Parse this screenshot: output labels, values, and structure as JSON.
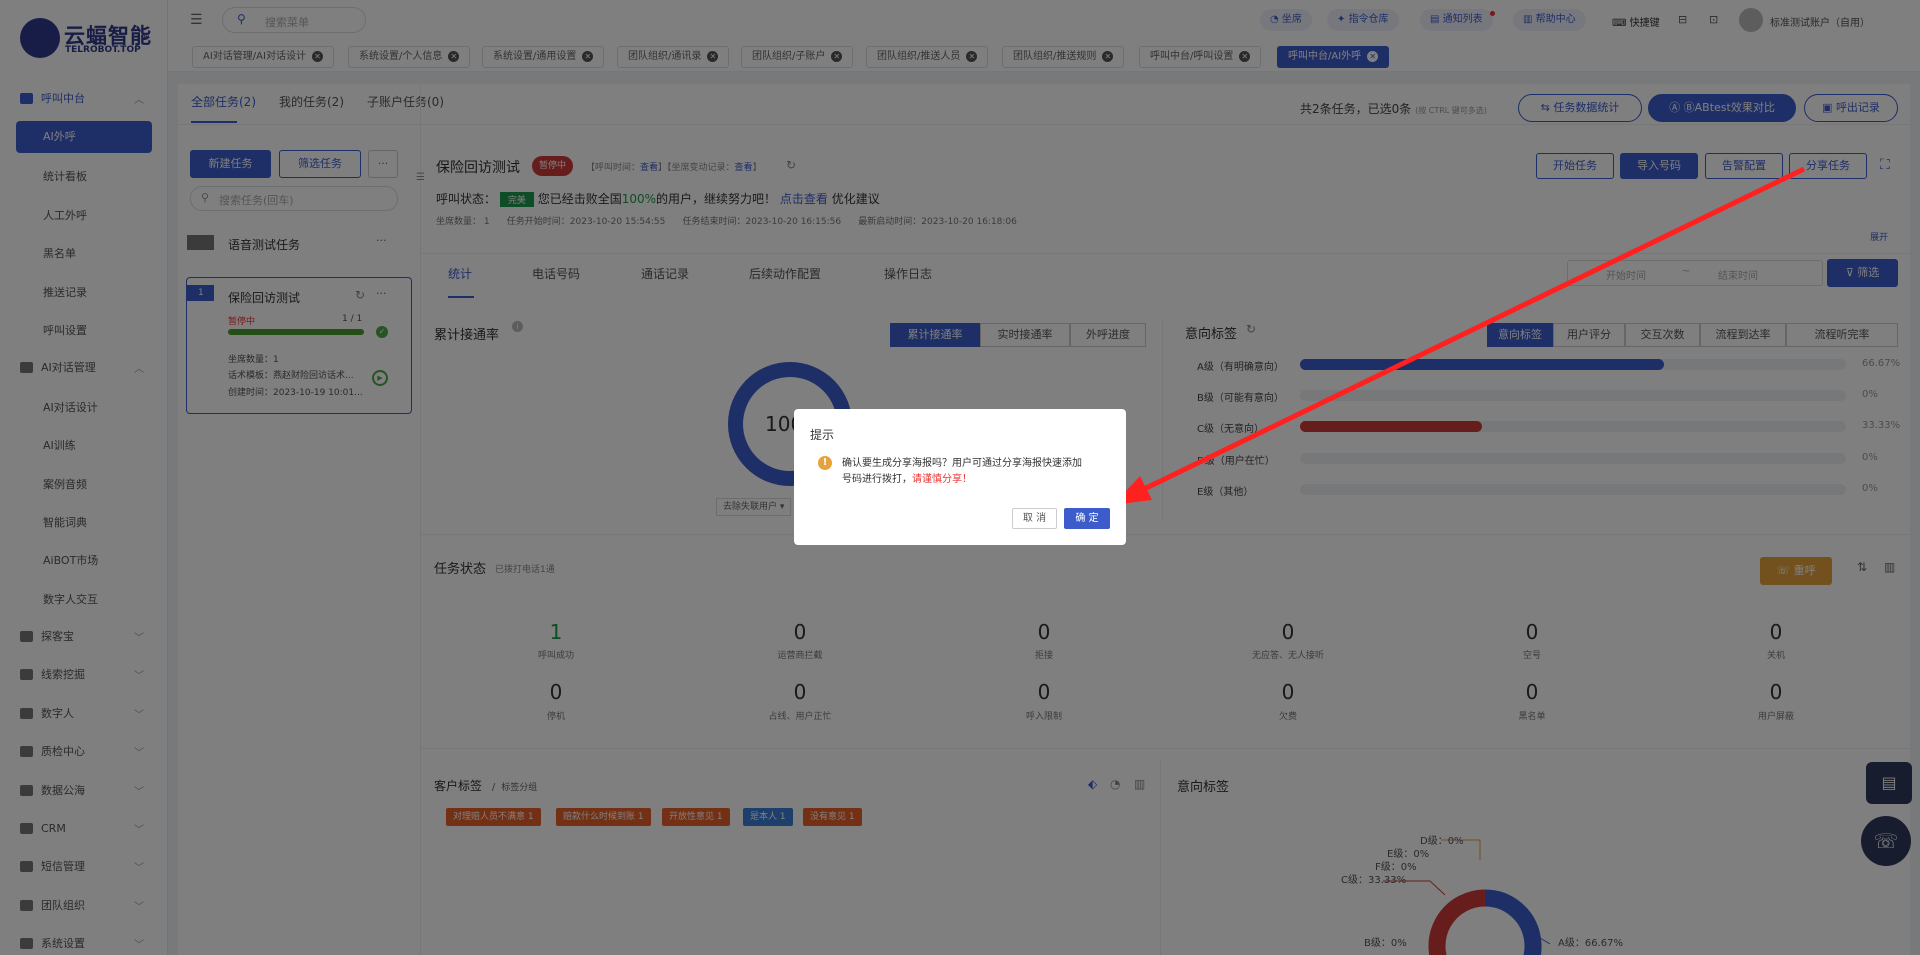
{
  "brand": {
    "name": "云蝠智能",
    "domain": "TELROBOT.TOP",
    "reg": "®"
  },
  "topbar": {
    "search_placeholder": "搜索菜单",
    "buttons": [
      "坐席",
      "指令仓库",
      "通知列表",
      "帮助中心"
    ],
    "shortcut": "快捷键",
    "account": "标准测试账户（自用）"
  },
  "page_tabs": [
    "AI对话管理/AI对话设计",
    "系统设置/个人信息",
    "系统设置/通用设置",
    "团队组织/通讯录",
    "团队组织/子账户",
    "团队组织/推送人员",
    "团队组织/推送规则",
    "呼叫中台/呼叫设置",
    "呼叫中台/AI外呼"
  ],
  "sidebar": {
    "group1": "呼叫中台",
    "group1_items": [
      "AI外呼",
      "统计看板",
      "人工外呼",
      "黑名单",
      "推送记录",
      "呼叫设置"
    ],
    "group2": "AI对话管理",
    "group2_items": [
      "AI对话设计",
      "AI训练",
      "案例音频",
      "智能词典",
      "AiBOT市场",
      "数字人交互"
    ],
    "groups": [
      "探客宝",
      "线索挖掘",
      "数字人",
      "质检中心",
      "数据公海",
      "CRM",
      "短信管理",
      "团队组织",
      "系统设置"
    ]
  },
  "task_tabs": [
    "全部任务(2)",
    "我的任务(2)",
    "子账户任务(0)"
  ],
  "task_summary": {
    "text": "共2条任务，已选0条",
    "hint": "(按 CTRL 键可多选)"
  },
  "top_actions": [
    "任务数据统计",
    "ABtest效果对比",
    "呼出记录"
  ],
  "left": {
    "new_task": "新建任务",
    "filter_task": "筛选任务",
    "more": "···",
    "search_placeholder": "搜索任务(回车)",
    "voice_task": "语音测试任务",
    "card": {
      "index": "1",
      "title": "保险回访测试",
      "status": "暂停中",
      "progress": "1 / 1",
      "progress_ratio": 1.0,
      "seats": "坐席数量：1",
      "template": "话术模板：燕赵财险回访话术...",
      "created": "创建时间：2023-10-19 10:01..."
    }
  },
  "detail": {
    "title": "保险回访测试",
    "status": "暂停中",
    "call_time_label": "【呼叫时间：",
    "view": "查看",
    "seat_label": "】【坐席变动记录：",
    "view2": "查看",
    "close_bracket": "】",
    "call_status_label": "呼叫状态：",
    "done": "完美",
    "msg_pre": "您已经击败全国",
    "msg_pct": "100%",
    "msg_post": "的用户，继续努力吧！",
    "click_view": "点击查看",
    "optimize": "优化建议",
    "meta": [
      "坐席数量：  1",
      "任务开始时间：2023-10-20 15:54:55",
      "任务结束时间：2023-10-20 16:15:56",
      "最新启动时间：2023-10-20 16:18:06"
    ],
    "actions": [
      "开始任务",
      "导入号码",
      "告警配置",
      "分享任务"
    ],
    "expand": "展开",
    "tabs": [
      "统计",
      "电话号码",
      "通话记录",
      "后续动作配置",
      "操作日志"
    ],
    "start_ph": "开始时间",
    "tilde": "~",
    "end_ph": "结束时间",
    "filter": "筛选"
  },
  "conn_rate": {
    "title": "累计接通率",
    "tabs": [
      "累计接通率",
      "实时接通率",
      "外呼进度"
    ],
    "value": "100",
    "dedupe": "去除失联用户"
  },
  "intent": {
    "title": "意向标签",
    "tabs": [
      "意向标签",
      "用户评分",
      "交互次数",
      "流程到达率",
      "流程听完率"
    ],
    "rows": [
      {
        "label": "A级（有明确意向）",
        "pct": "66.67%",
        "ratio": 0.6667,
        "color": "#3d5ccc"
      },
      {
        "label": "B级（可能有意向）",
        "pct": "0%",
        "ratio": 0,
        "color": "#3d5ccc"
      },
      {
        "label": "C级（无意向）",
        "pct": "33.33%",
        "ratio": 0.3333,
        "color": "#d03a3a"
      },
      {
        "label": "D级（用户在忙）",
        "pct": "0%",
        "ratio": 0,
        "color": "#3d5ccc"
      },
      {
        "label": "E级（其他）",
        "pct": "0%",
        "ratio": 0,
        "color": "#3d5ccc"
      }
    ]
  },
  "task_status": {
    "title": "任务状态",
    "sub": "已拨打电话1通",
    "redial": "重呼",
    "row1": [
      {
        "n": "1",
        "l": "呼叫成功"
      },
      {
        "n": "0",
        "l": "运营商拦截"
      },
      {
        "n": "0",
        "l": "拒接"
      },
      {
        "n": "0",
        "l": "无应答、无人接听"
      },
      {
        "n": "0",
        "l": "空号"
      },
      {
        "n": "0",
        "l": "关机"
      }
    ],
    "row2": [
      {
        "n": "0",
        "l": "停机"
      },
      {
        "n": "0",
        "l": "占线、用户正忙"
      },
      {
        "n": "0",
        "l": "呼入限制"
      },
      {
        "n": "0",
        "l": "欠费"
      },
      {
        "n": "0",
        "l": "黑名单"
      },
      {
        "n": "0",
        "l": "用户屏蔽"
      }
    ]
  },
  "customer_tags": {
    "title": "客户标签",
    "slash": "/",
    "group": "标签分组",
    "tags": [
      {
        "text": "对理赔人员不满意 1",
        "color": "#e8612a"
      },
      {
        "text": "赔款什么时候到账 1",
        "color": "#e8612a"
      },
      {
        "text": "开放性意见 1",
        "color": "#e8612a"
      },
      {
        "text": "是本人 1",
        "color": "#3d7fd6"
      },
      {
        "text": "没有意见 1",
        "color": "#e8612a"
      }
    ]
  },
  "intent2": {
    "title": "意向标签",
    "labels": [
      "D级：0%",
      "E级：0%",
      "F级：0%",
      "C级：33.33%",
      "B级：0%",
      "A级：66.67%"
    ]
  },
  "dialog": {
    "title": "提示",
    "msg1": "确认要生成分享海报吗？用户可通过分享海报快速添加",
    "msg2": "号码进行拨打，",
    "warn": "请谨慎分享！",
    "cancel": "取 消",
    "ok": "确 定"
  }
}
